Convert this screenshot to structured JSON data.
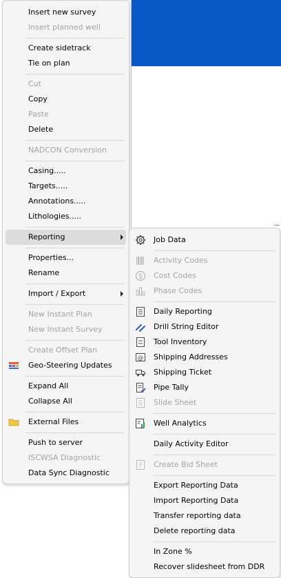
{
  "main_menu": {
    "items": [
      {
        "label": "Insert new survey",
        "enabled": true
      },
      {
        "label": "Insert planned well",
        "enabled": false
      },
      {
        "label": "Create sidetrack",
        "enabled": true
      },
      {
        "label": "Tie on plan",
        "enabled": true
      },
      {
        "label": "Cut",
        "enabled": false
      },
      {
        "label": "Copy",
        "enabled": true
      },
      {
        "label": "Paste",
        "enabled": false
      },
      {
        "label": "Delete",
        "enabled": true
      },
      {
        "label": "NADCON Conversion",
        "enabled": false
      },
      {
        "label": "Casing.....",
        "enabled": true
      },
      {
        "label": "Targets.....",
        "enabled": true
      },
      {
        "label": "Annotations.....",
        "enabled": true
      },
      {
        "label": "Lithologies.....",
        "enabled": true
      },
      {
        "label": "Reporting",
        "enabled": true,
        "highlighted": true,
        "submenu": true
      },
      {
        "label": "Properties...",
        "enabled": true
      },
      {
        "label": "Rename",
        "enabled": true
      },
      {
        "label": "Import / Export",
        "enabled": true,
        "submenu": true
      },
      {
        "label": "New Instant Plan",
        "enabled": false
      },
      {
        "label": "New Instant Survey",
        "enabled": false
      },
      {
        "label": "Create Offset Plan",
        "enabled": false
      },
      {
        "label": "Geo-Steering Updates",
        "enabled": true,
        "icon": "geo-steering-icon"
      },
      {
        "label": "Expand All",
        "enabled": true
      },
      {
        "label": "Collapse All",
        "enabled": true
      },
      {
        "label": "External Files",
        "enabled": true,
        "icon": "folder-icon"
      },
      {
        "label": "Push to server",
        "enabled": true
      },
      {
        "label": "ISCWSA Diagnostic",
        "enabled": false
      },
      {
        "label": "Data Sync Diagnostic",
        "enabled": true
      }
    ]
  },
  "reporting_submenu": {
    "items": [
      {
        "label": "Job Data",
        "enabled": true,
        "icon": "gear-icon"
      },
      {
        "label": "Activity Codes",
        "enabled": false,
        "icon": "barcode-icon"
      },
      {
        "label": "Cost Codes",
        "enabled": false,
        "icon": "dollar-icon"
      },
      {
        "label": "Phase Codes",
        "enabled": false,
        "icon": "bar-chart-icon"
      },
      {
        "label": "Daily Reporting",
        "enabled": true,
        "icon": "report-icon"
      },
      {
        "label": "Drill String Editor",
        "enabled": true,
        "icon": "drill-string-icon"
      },
      {
        "label": "Tool Inventory",
        "enabled": true,
        "icon": "inventory-icon"
      },
      {
        "label": "Shipping Addresses",
        "enabled": true,
        "icon": "address-icon"
      },
      {
        "label": "Shipping Ticket",
        "enabled": true,
        "icon": "truck-icon"
      },
      {
        "label": "Pipe Tally",
        "enabled": true,
        "icon": "tally-icon"
      },
      {
        "label": "Slide Sheet",
        "enabled": false,
        "icon": "slide-sheet-icon"
      },
      {
        "label": "Well Analytics",
        "enabled": true,
        "icon": "analytics-icon"
      },
      {
        "label": "Daily Activity Editor",
        "enabled": true
      },
      {
        "label": "Create Bid Sheet",
        "enabled": false,
        "icon": "bid-sheet-icon"
      },
      {
        "label": "Export Reporting Data",
        "enabled": true
      },
      {
        "label": "Import Reporting Data",
        "enabled": true
      },
      {
        "label": "Transfer reporting data",
        "enabled": true
      },
      {
        "label": "Delete reporting data",
        "enabled": true
      },
      {
        "label": "In Zone %",
        "enabled": true
      },
      {
        "label": "Recover slidesheet from DDR",
        "enabled": true
      }
    ]
  }
}
